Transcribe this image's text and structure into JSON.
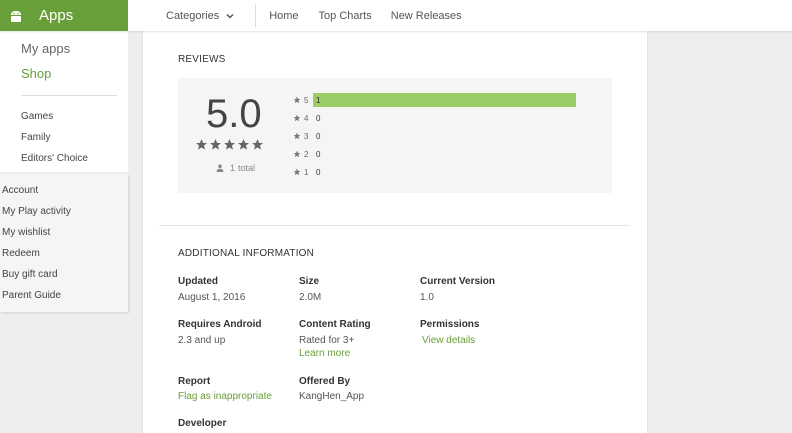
{
  "header": {
    "brand": "Apps",
    "brand_icon": "android-icon",
    "nav": {
      "categories": "Categories",
      "home": "Home",
      "top_charts": "Top Charts",
      "new_releases": "New Releases"
    },
    "accent_color": "#689f38"
  },
  "sidebar": {
    "my_apps": "My apps",
    "shop": "Shop",
    "sections": [
      "Games",
      "Family",
      "Editors' Choice"
    ],
    "account_links": [
      "Account",
      "My Play activity",
      "My wishlist",
      "Redeem",
      "Buy gift card",
      "Parent Guide"
    ]
  },
  "reviews": {
    "title": "REVIEWS",
    "score": "5.0",
    "stars_filled": 5,
    "total_count": "1",
    "total_label": "total",
    "histogram": [
      {
        "stars": "5",
        "count": "1",
        "fraction": 1.0
      },
      {
        "stars": "4",
        "count": "0",
        "fraction": 0
      },
      {
        "stars": "3",
        "count": "0",
        "fraction": 0
      },
      {
        "stars": "2",
        "count": "0",
        "fraction": 0
      },
      {
        "stars": "1",
        "count": "0",
        "fraction": 0
      }
    ],
    "bar_color": "#9ccc65"
  },
  "additional": {
    "title": "ADDITIONAL INFORMATION",
    "updated_label": "Updated",
    "updated_value": "August 1, 2016",
    "size_label": "Size",
    "size_value": "2.0M",
    "version_label": "Current Version",
    "version_value": "1.0",
    "requires_label": "Requires Android",
    "requires_value": "2.3 and up",
    "rating_label": "Content Rating",
    "rating_value": "Rated for 3+",
    "learn_more": "Learn more",
    "permissions_label": "Permissions",
    "view_details": "View details",
    "report_label": "Report",
    "flag_link": "Flag as inappropriate",
    "offered_label": "Offered By",
    "offered_value": "KangHen_App",
    "developer_label": "Developer"
  }
}
